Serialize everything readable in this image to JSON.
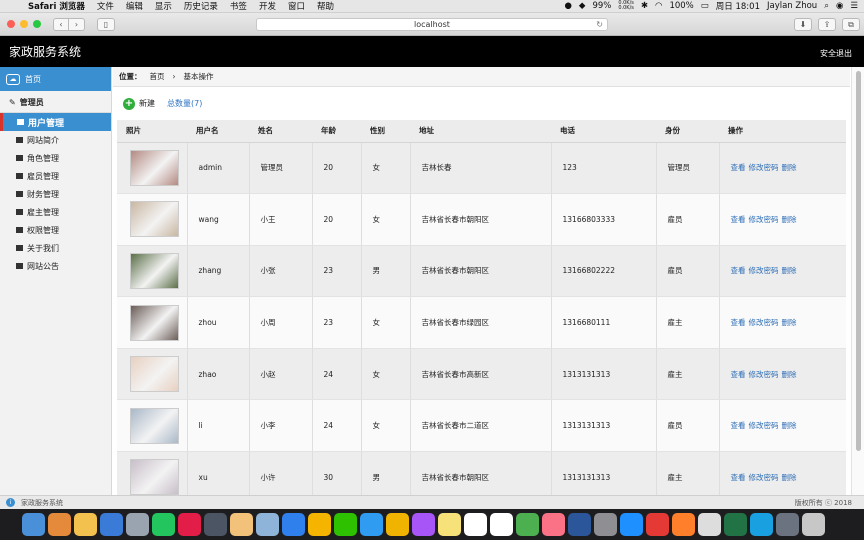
{
  "menubar": {
    "app": "Safari 浏览器",
    "items": [
      "文件",
      "编辑",
      "显示",
      "历史记录",
      "书签",
      "开发",
      "窗口",
      "帮助"
    ],
    "battery": "99%",
    "net_up": "0.0K/s",
    "net_down": "0.0K/s",
    "volume": "100%",
    "clock": "周日 18:01",
    "user": "Jaylan Zhou"
  },
  "browser": {
    "address": "localhost"
  },
  "app": {
    "title": "家政服务系统",
    "logout": "安全退出"
  },
  "sidebar": {
    "home": "首页",
    "section": "管理员",
    "active": "用户管理",
    "items": [
      "网站简介",
      "角色管理",
      "雇员管理",
      "财务管理",
      "雇主管理",
      "权限管理",
      "关于我们",
      "网站公告"
    ]
  },
  "breadcrumb": {
    "label": "位置：",
    "home": "首页",
    "sep": "›",
    "current": "基本操作"
  },
  "actions": {
    "new": "新建",
    "total": "总数量(7)"
  },
  "table": {
    "headers": [
      "照片",
      "用户名",
      "姓名",
      "年龄",
      "性别",
      "地址",
      "电话",
      "身份",
      "操作"
    ],
    "link_view": "查看",
    "link_pwd": "修改密码",
    "link_delete": "删除",
    "rows": [
      {
        "username": "admin",
        "name": "管理员",
        "age": "20",
        "gender": "女",
        "address": "吉林长春",
        "phone": "123",
        "role": "管理员",
        "photo_color": "#b48a82"
      },
      {
        "username": "wang",
        "name": "小王",
        "age": "20",
        "gender": "女",
        "address": "吉林省长春市朝阳区",
        "phone": "13166803333",
        "role": "雇员",
        "photo_color": "#c9b7a2"
      },
      {
        "username": "zhang",
        "name": "小张",
        "age": "23",
        "gender": "男",
        "address": "吉林省长春市朝阳区",
        "phone": "13166802222",
        "role": "雇员",
        "photo_color": "#5b6f48"
      },
      {
        "username": "zhou",
        "name": "小周",
        "age": "23",
        "gender": "女",
        "address": "吉林省长春市绿园区",
        "phone": "1316680111",
        "role": "雇主",
        "photo_color": "#6b5d58"
      },
      {
        "username": "zhao",
        "name": "小赵",
        "age": "24",
        "gender": "女",
        "address": "吉林省长春市高新区",
        "phone": "1313131313",
        "role": "雇主",
        "photo_color": "#e8d0c0"
      },
      {
        "username": "li",
        "name": "小李",
        "age": "24",
        "gender": "女",
        "address": "吉林省长春市二道区",
        "phone": "1313131313",
        "role": "雇员",
        "photo_color": "#a9b8c8"
      },
      {
        "username": "xu",
        "name": "小许",
        "age": "30",
        "gender": "男",
        "address": "吉林省长春市朝阳区",
        "phone": "1313131313",
        "role": "雇主",
        "photo_color": "#c8bec8"
      }
    ]
  },
  "footer": {
    "left": "家政服务系统",
    "right": "版权所有 ⓒ 2018"
  },
  "colors": {
    "accent": "#3a8fd0",
    "header": "#000000",
    "link": "#2b6cb5",
    "new_button": "#2fae3c"
  },
  "dock_icons": [
    "finder",
    "books",
    "photos",
    "preview",
    "launchpad",
    "pycharm",
    "intellij",
    "sublime",
    "cyberduck",
    "sequel",
    "safari",
    "chrome",
    "wechat",
    "qq",
    "qqbrowser",
    "rp",
    "notes",
    "reminders",
    "calendar",
    "maps",
    "itunes",
    "word",
    "preferences",
    "baidu",
    "qq2",
    "sublime2",
    "textedit",
    "excel",
    "qqmusic",
    "downloads",
    "trash"
  ]
}
